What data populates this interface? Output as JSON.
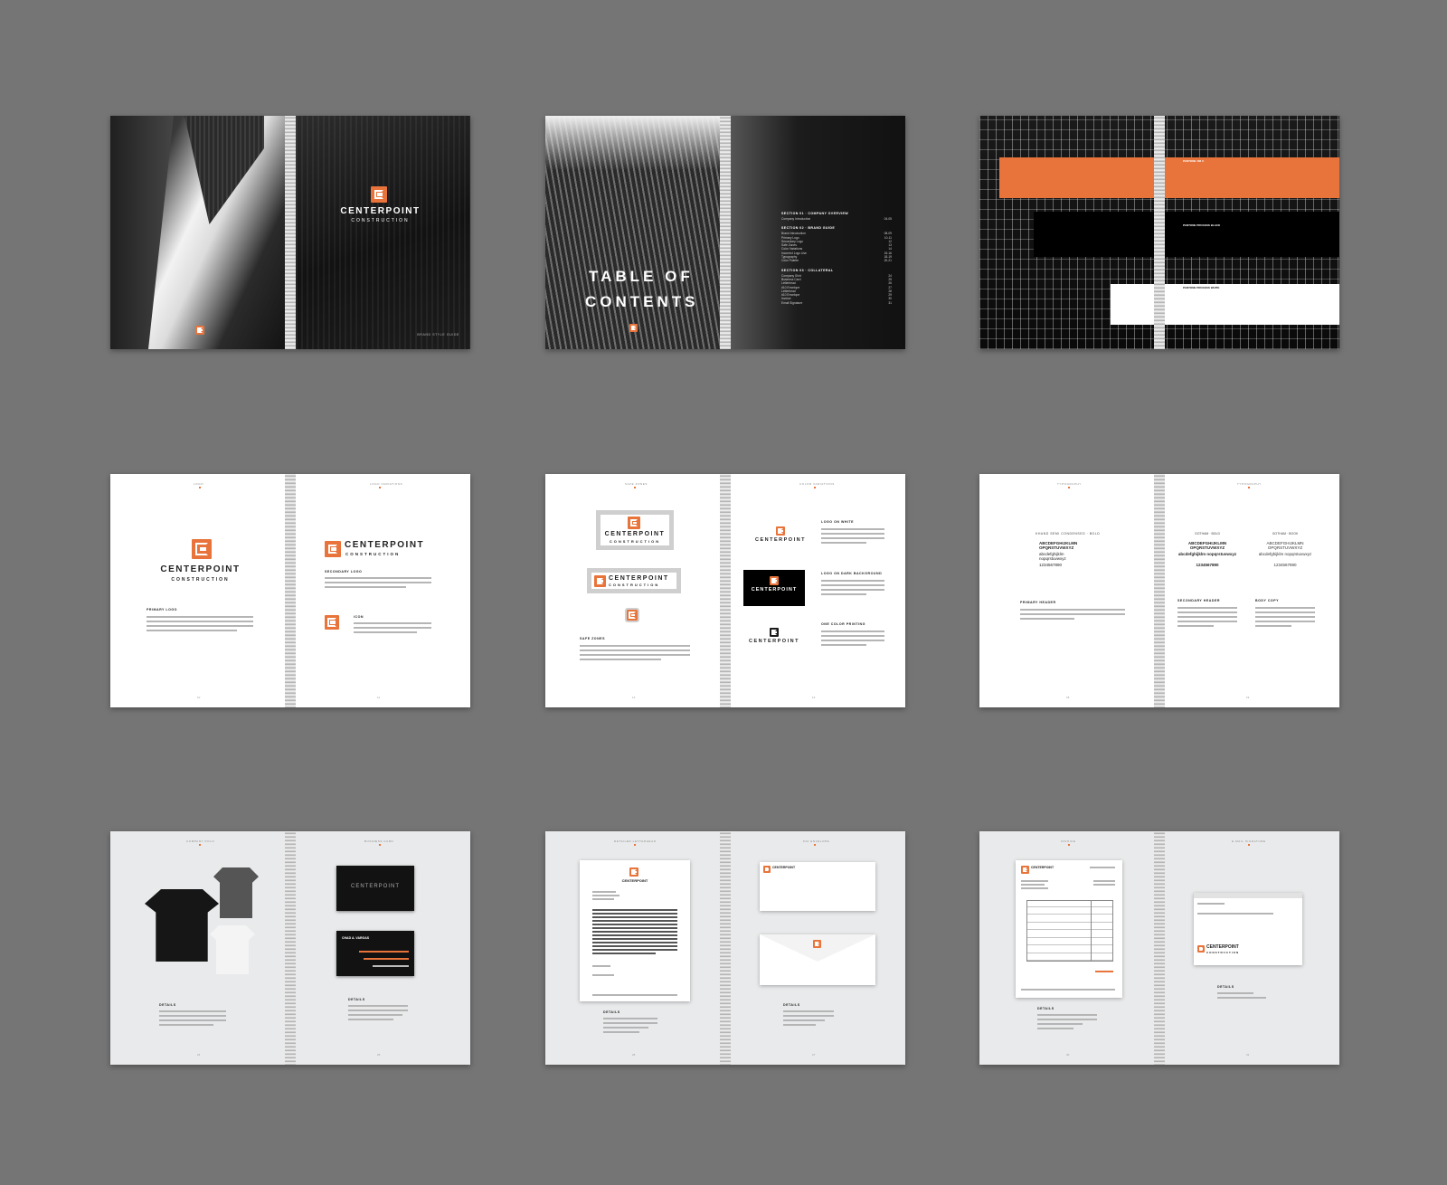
{
  "colors": {
    "background": "#757575",
    "accent": "#e8743b",
    "dark": "#141414",
    "light_gray": "#e9eaeb"
  },
  "icons": [
    "centerpoint-logo-icon",
    "spiral-binding",
    "polo-shirt"
  ],
  "cover": {
    "brand": "CENTERPOINT",
    "sub": "CONSTRUCTION",
    "footer": "BRAND STYLE GUIDE"
  },
  "toc": {
    "title_line1": "TABLE OF",
    "title_line2": "CONTENTS",
    "sections": [
      {
        "heading": "SECTION 01 · COMPANY OVERVIEW",
        "items": [
          [
            "Company Introduction",
            "04-05"
          ]
        ]
      },
      {
        "heading": "SECTION 02 · BRAND GUIDE",
        "items": [
          [
            "Brand Introduction",
            "08-09"
          ],
          [
            "Primary Logo",
            "10-11"
          ],
          [
            "Secondary Logo",
            "12"
          ],
          [
            "Safe Zones",
            "13"
          ],
          [
            "Color Variations",
            "14"
          ],
          [
            "Incorrect Logo Use",
            "15-16"
          ],
          [
            "Typography",
            "18-19"
          ],
          [
            "Color Palette",
            "20-21"
          ]
        ]
      },
      {
        "heading": "SECTION 03 · COLLATERAL",
        "items": [
          [
            "Company Shirt",
            "24"
          ],
          [
            "Business Card",
            "25"
          ],
          [
            "Letterhead",
            "26"
          ],
          [
            "#10 Envelope",
            "27"
          ],
          [
            "Letterhead",
            "28"
          ],
          [
            "#10 Envelope",
            "29"
          ],
          [
            "Invoice",
            "30"
          ],
          [
            "Email Signature",
            "31"
          ]
        ]
      }
    ]
  },
  "palette": {
    "bands": [
      {
        "label": "PANTONE 166 C"
      },
      {
        "label": "PANTONE PROCESS BLACK"
      },
      {
        "label": "PANTONE PROCESS WHITE"
      }
    ]
  },
  "logo_pages": {
    "left_head": "LOGO",
    "right_head": "LOGO VARIATIONS",
    "primary": "PRIMARY LOGO",
    "secondary": "SECONDARY LOGO",
    "icon": "ICON",
    "nums": [
      "10",
      "11"
    ]
  },
  "safe_pages": {
    "left_head": "SAFE ZONES",
    "right_head": "COLOR VARIATIONS",
    "safe_title": "SAFE ZONES",
    "on_white": "LOGO ON WHITE",
    "on_dark": "LOGO ON DARK BACKGROUND",
    "one_color": "ONE COLOR PRINTING",
    "nums": [
      "12",
      "13"
    ]
  },
  "type_pages": {
    "left_head": "TYPOGRAPHY",
    "right_head": "TYPOGRAPHY",
    "font1": "KHAND SEMI CONDENSED · BOLD",
    "font2": "GOTHAM · BOLD",
    "font3": "GOTHAM · BOOK",
    "alpha_upper": "ABCDEFGHIJKLMN OPQRSTUVWXYZ",
    "alpha_lower": "abcdefghijklm nopqrstuvwxyz",
    "digits": "1234567890",
    "primary_header": "PRIMARY HEADER",
    "secondary_header": "SECONDARY HEADER",
    "body_copy": "BODY COPY",
    "nums": [
      "18",
      "19"
    ]
  },
  "apparel_pages": {
    "left_head": "COMPANY POLO",
    "right_head": "BUSINESS CARD",
    "details": "DETAILS",
    "card_name": "CHAD A. VARGAS",
    "nums": [
      "24",
      "25"
    ]
  },
  "letter_pages": {
    "left_head": "DETAILED LETTERHEAD",
    "right_head": "#10 ENVELOPE",
    "details": "DETAILS",
    "nums": [
      "26",
      "27"
    ]
  },
  "invoice_pages": {
    "left_head": "INVOICE",
    "right_head": "E-MAIL SIGNATURE",
    "details": "DETAILS",
    "nums": [
      "30",
      "31"
    ]
  }
}
